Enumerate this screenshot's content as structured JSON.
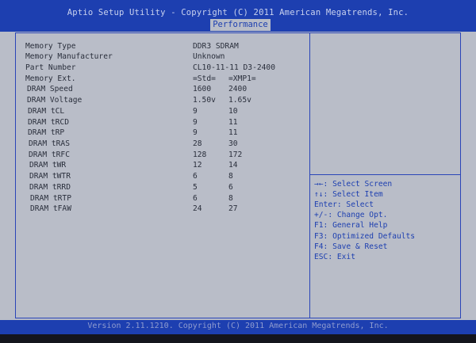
{
  "header": {
    "title": "Aptio Setup Utility - Copyright (C) 2011 American Megatrends, Inc.",
    "active_tab": "Performance"
  },
  "rows": [
    {
      "label": "Memory Type",
      "v1": "DDR3 SDRAM",
      "v2": ""
    },
    {
      "label": "Memory Manufacturer",
      "v1": "Unknown",
      "v2": ""
    },
    {
      "label": "Part Number",
      "v1": "CL10-11-11 D3-2400",
      "v2": ""
    },
    {
      "label": "Memory Ext.",
      "v1": "=Std=",
      "v2": "=XMP1="
    },
    {
      "label": "DRAM Speed",
      "v1": "1600",
      "v2": "2400"
    },
    {
      "label": "DRAM Voltage",
      "v1": "1.50v",
      "v2": "1.65v"
    },
    {
      "label": "DRAM tCL",
      "v1": "9",
      "v2": "10"
    },
    {
      "label": "DRAM tRCD",
      "v1": "9",
      "v2": "11"
    },
    {
      "label": "DRAM tRP",
      "v1": "9",
      "v2": "11"
    },
    {
      "label": "DRAM tRAS",
      "v1": "28",
      "v2": "30"
    },
    {
      "label": "DRAM tRFC",
      "v1": "128",
      "v2": "172"
    },
    {
      "label": "DRAM tWR",
      "v1": "12",
      "v2": "14"
    },
    {
      "label": "DRAM tWTR",
      "v1": "6",
      "v2": "8"
    },
    {
      "label": "DRAM tRRD",
      "v1": "5",
      "v2": "6"
    },
    {
      "label": "DRAM tRTP",
      "v1": "6",
      "v2": "8"
    },
    {
      "label": "DRAM tFAW",
      "v1": "24",
      "v2": "27"
    }
  ],
  "help": [
    "→←: Select Screen",
    "↑↓: Select Item",
    "Enter: Select",
    "+/-: Change Opt.",
    "F1: General Help",
    "F3: Optimized Defaults",
    "F4: Save & Reset",
    "ESC: Exit"
  ],
  "footer": {
    "text": "Version 2.11.1210. Copyright (C) 2011 American Megatrends, Inc."
  },
  "colors": {
    "bar_blue": "#1d3fb0",
    "panel_gray": "#b9bdc8",
    "text_dark": "#2a2f3c",
    "help_blue": "#1d3fb0"
  }
}
